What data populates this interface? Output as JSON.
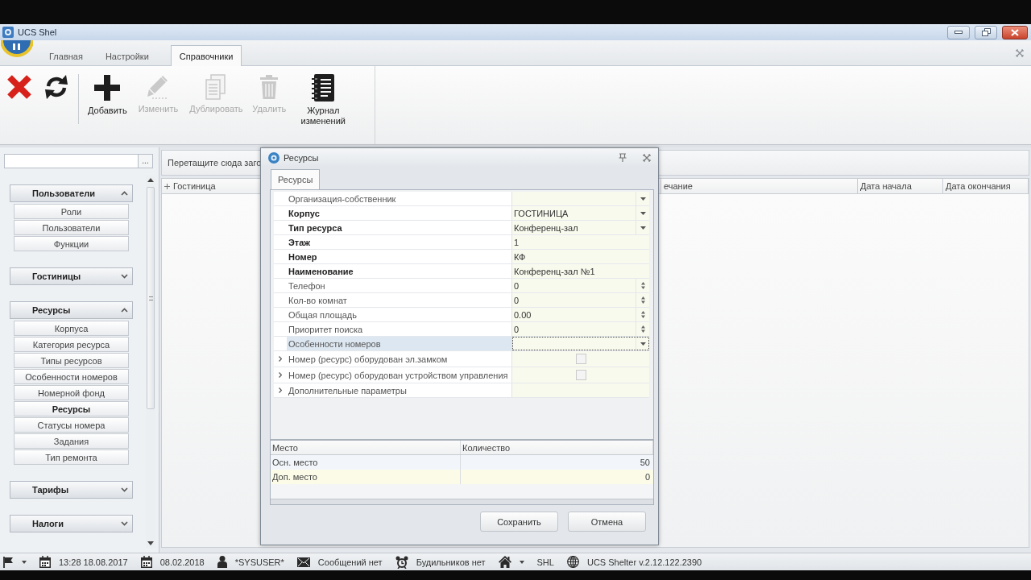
{
  "window": {
    "title": "UCS Shel"
  },
  "ribbon": {
    "tabs": [
      {
        "label": "Главная",
        "selected": false
      },
      {
        "label": "Настройки",
        "selected": false
      },
      {
        "label": "Справочники",
        "selected": true
      }
    ],
    "buttons": [
      {
        "kind": "cancel",
        "disabled": false
      },
      {
        "kind": "refresh",
        "disabled": false
      },
      {
        "kind": "add",
        "label": "Добавить",
        "disabled": false
      },
      {
        "kind": "edit",
        "label": "Изменить",
        "disabled": true
      },
      {
        "kind": "duplicate",
        "label": "Дублировать",
        "disabled": true
      },
      {
        "kind": "delete",
        "label": "Удалить",
        "disabled": true
      },
      {
        "kind": "journal",
        "label": "Журнал изменений",
        "disabled": false
      }
    ]
  },
  "sidebar": {
    "browse_button": "...",
    "groups": [
      {
        "title": "Пользователи",
        "expanded": true,
        "items": [
          {
            "label": "Роли",
            "selected": false
          },
          {
            "label": "Пользователи",
            "selected": false
          },
          {
            "label": "Функции",
            "selected": false
          }
        ]
      },
      {
        "title": "Гостиницы",
        "expanded": false
      },
      {
        "title": "Ресурсы",
        "expanded": true,
        "items": [
          {
            "label": "Корпуса",
            "selected": false
          },
          {
            "label": "Категория ресурса",
            "selected": false
          },
          {
            "label": "Типы ресурсов",
            "selected": false
          },
          {
            "label": "Особенности номеров",
            "selected": false
          },
          {
            "label": "Номерной фонд",
            "selected": false
          },
          {
            "label": "Ресурсы",
            "selected": true
          },
          {
            "label": "Статусы номера",
            "selected": false
          },
          {
            "label": "Задания",
            "selected": false
          },
          {
            "label": "Тип ремонта",
            "selected": false
          }
        ]
      },
      {
        "title": "Тарифы",
        "expanded": false
      },
      {
        "title": "Налоги",
        "expanded": false
      }
    ]
  },
  "grid": {
    "group_panel": "Перетащите сюда заго",
    "columns": [
      "Гостиница",
      "ечание",
      "Дата начала",
      "Дата окончания"
    ]
  },
  "dialog": {
    "title": "Ресурсы",
    "tabs": [
      {
        "label": "Ресурсы",
        "selected": true
      }
    ],
    "properties": [
      {
        "label": "Организация-собственник",
        "kind": "dropdown",
        "required": false,
        "selected": false,
        "expandable": false
      },
      {
        "label": "Корпус",
        "value": "ГОСТИНИЦА",
        "kind": "dropdown",
        "required": true,
        "selected": false,
        "expandable": false
      },
      {
        "label": "Тип ресурса",
        "value": "Конференц-зал",
        "kind": "dropdown",
        "required": true,
        "selected": false,
        "expandable": false
      },
      {
        "label": "Этаж",
        "value": "1",
        "kind": "text",
        "required": true,
        "selected": false,
        "expandable": false
      },
      {
        "label": "Номер",
        "value": "КФ",
        "kind": "text",
        "required": true,
        "selected": false,
        "expandable": false
      },
      {
        "label": "Наименование",
        "value": "Конференц-зал №1",
        "kind": "text",
        "required": true,
        "selected": false,
        "expandable": false
      },
      {
        "label": "Телефон",
        "value": "0",
        "kind": "spin",
        "required": false,
        "selected": false,
        "expandable": false
      },
      {
        "label": "Кол-во комнат",
        "value": "0",
        "kind": "spin",
        "required": false,
        "selected": false,
        "expandable": false
      },
      {
        "label": "Общая площадь",
        "value": "0.00",
        "kind": "spin",
        "required": false,
        "selected": false,
        "expandable": false
      },
      {
        "label": "Приоритет поиска",
        "value": "0",
        "kind": "spin",
        "required": false,
        "selected": false,
        "expandable": false
      },
      {
        "label": "Особенности номеров",
        "kind": "dropdown",
        "required": false,
        "selected": true,
        "expandable": false
      },
      {
        "label": "Номер (ресурс) оборудован эл.замком",
        "kind": "checkbox",
        "checked": false,
        "required": false,
        "selected": false,
        "expandable": true
      },
      {
        "label": "Номер (ресурс) оборудован устройством управления",
        "kind": "checkbox",
        "checked": false,
        "required": false,
        "selected": false,
        "expandable": true
      },
      {
        "label": "Дополнительные параметры",
        "kind": "group",
        "required": false,
        "selected": false,
        "expandable": true
      }
    ],
    "places": {
      "columns": [
        "Место",
        "Количество"
      ],
      "rows": [
        [
          "Осн. место",
          "50"
        ],
        [
          "Доп. место",
          "0"
        ]
      ]
    },
    "buttons": [
      "Сохранить",
      "Отмена"
    ]
  },
  "status_bar": {
    "items": [
      {
        "kind": "flag",
        "dropdown": true
      },
      {
        "kind": "calendar",
        "text": "13:28 18.08.2017",
        "dropdown": false
      },
      {
        "kind": "calendar",
        "text": "08.02.2018",
        "dropdown": false
      },
      {
        "kind": "user",
        "text": "*SYSUSER*",
        "dropdown": false
      },
      {
        "kind": "mail",
        "text": "Сообщений нет",
        "dropdown": false
      },
      {
        "kind": "alarm",
        "text": "Будильников нет",
        "dropdown": false
      },
      {
        "kind": "home",
        "dropdown": true
      },
      {
        "kind": "text",
        "text": "SHL",
        "dropdown": false
      },
      {
        "kind": "globe",
        "text": "UCS Shelter v.2.12.122.2390",
        "dropdown": false
      }
    ]
  }
}
